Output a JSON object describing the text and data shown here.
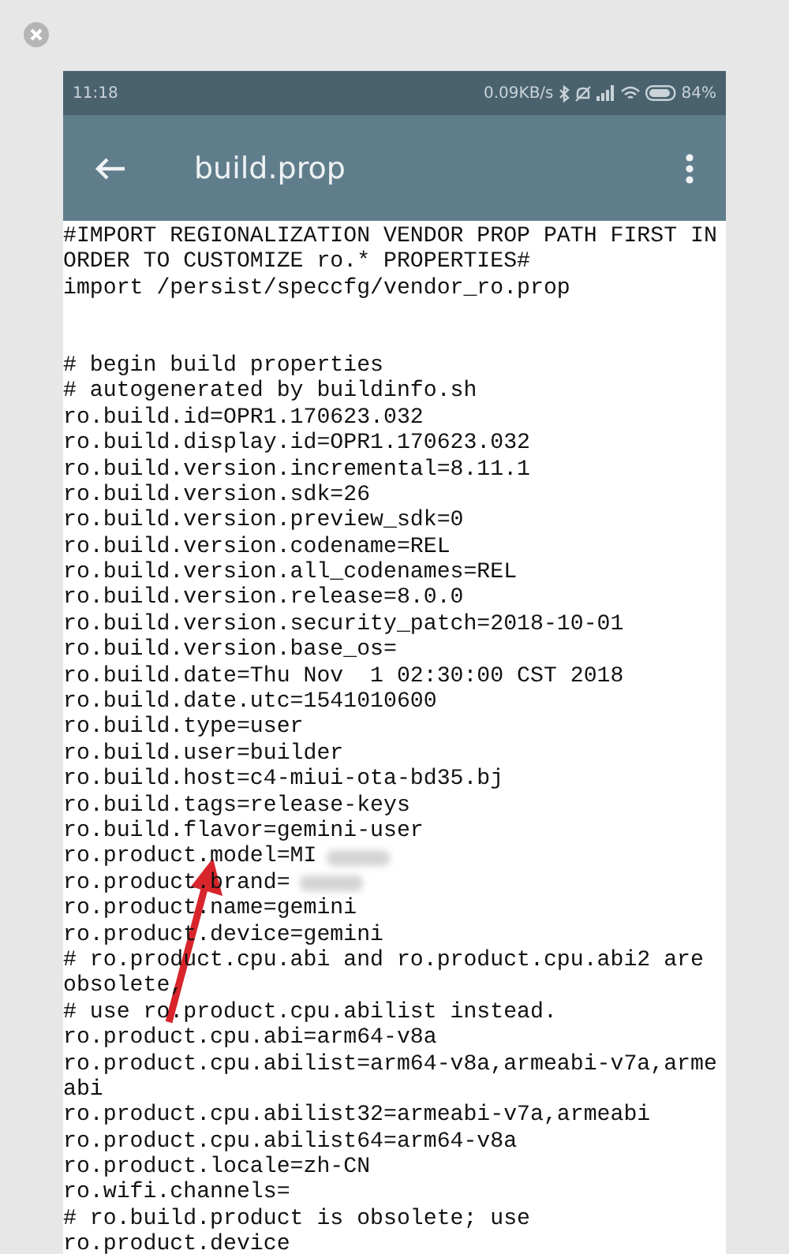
{
  "status_bar": {
    "time": "11:18",
    "speed": "0.09KB/s",
    "battery": "84%"
  },
  "app_bar": {
    "title": "build.prop"
  },
  "lines": [
    {
      "kind": "text",
      "text": "#IMPORT REGIONALIZATION VENDOR PROP PATH FIRST IN"
    },
    {
      "kind": "text",
      "text": "ORDER TO CUSTOMIZE ro.* PROPERTIES#"
    },
    {
      "kind": "text",
      "text": "import /persist/speccfg/vendor_ro.prop"
    },
    {
      "kind": "blank"
    },
    {
      "kind": "blank"
    },
    {
      "kind": "text",
      "text": "# begin build properties"
    },
    {
      "kind": "text",
      "text": "# autogenerated by buildinfo.sh"
    },
    {
      "kind": "text",
      "text": "ro.build.id=OPR1.170623.032"
    },
    {
      "kind": "text",
      "text": "ro.build.display.id=OPR1.170623.032"
    },
    {
      "kind": "text",
      "text": "ro.build.version.incremental=8.11.1"
    },
    {
      "kind": "text",
      "text": "ro.build.version.sdk=26"
    },
    {
      "kind": "text",
      "text": "ro.build.version.preview_sdk=0"
    },
    {
      "kind": "text",
      "text": "ro.build.version.codename=REL"
    },
    {
      "kind": "text",
      "text": "ro.build.version.all_codenames=REL"
    },
    {
      "kind": "text",
      "text": "ro.build.version.release=8.0.0"
    },
    {
      "kind": "text",
      "text": "ro.build.version.security_patch=2018-10-01"
    },
    {
      "kind": "text",
      "text": "ro.build.version.base_os="
    },
    {
      "kind": "text",
      "text": "ro.build.date=Thu Nov  1 02:30:00 CST 2018"
    },
    {
      "kind": "text",
      "text": "ro.build.date.utc=1541010600"
    },
    {
      "kind": "text",
      "text": "ro.build.type=user"
    },
    {
      "kind": "text",
      "text": "ro.build.user=builder"
    },
    {
      "kind": "text",
      "text": "ro.build.host=c4-miui-ota-bd35.bj"
    },
    {
      "kind": "text",
      "text": "ro.build.tags=release-keys"
    },
    {
      "kind": "text",
      "text": "ro.build.flavor=gemini-user"
    },
    {
      "kind": "redacted",
      "text": "ro.product.model=MI"
    },
    {
      "kind": "redacted",
      "text": "ro.product.brand="
    },
    {
      "kind": "text",
      "text": "ro.product.name=gemini"
    },
    {
      "kind": "text",
      "text": "ro.product.device=gemini"
    },
    {
      "kind": "text",
      "text": "# ro.product.cpu.abi and ro.product.cpu.abi2 are"
    },
    {
      "kind": "text",
      "text": "obsolete,"
    },
    {
      "kind": "text",
      "text": "# use ro.product.cpu.abilist instead."
    },
    {
      "kind": "text",
      "text": "ro.product.cpu.abi=arm64-v8a"
    },
    {
      "kind": "text",
      "text": "ro.product.cpu.abilist=arm64-v8a,armeabi-v7a,arme"
    },
    {
      "kind": "text",
      "text": "abi"
    },
    {
      "kind": "text",
      "text": "ro.product.cpu.abilist32=armeabi-v7a,armeabi"
    },
    {
      "kind": "text",
      "text": "ro.product.cpu.abilist64=arm64-v8a"
    },
    {
      "kind": "text",
      "text": "ro.product.locale=zh-CN"
    },
    {
      "kind": "text",
      "text": "ro.wifi.channels="
    },
    {
      "kind": "text",
      "text": "# ro.build.product is obsolete; use"
    },
    {
      "kind": "text",
      "text": "ro.product.device"
    }
  ]
}
